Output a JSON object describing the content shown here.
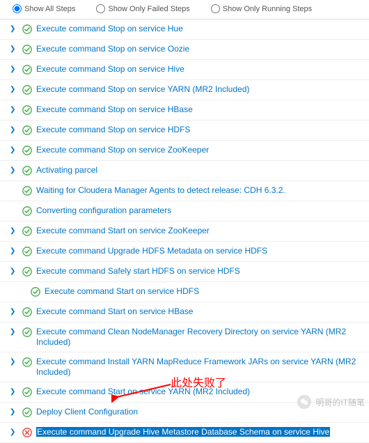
{
  "filters": {
    "all": "Show All Steps",
    "failed": "Show Only Failed Steps",
    "running": "Show Only Running Steps",
    "selected": "all"
  },
  "steps": [
    {
      "label": "Execute command Stop on service Hue",
      "status": "ok",
      "expandable": true
    },
    {
      "label": "Execute command Stop on service Oozie",
      "status": "ok",
      "expandable": true
    },
    {
      "label": "Execute command Stop on service Hive",
      "status": "ok",
      "expandable": true
    },
    {
      "label": "Execute command Stop on service YARN (MR2 Included)",
      "status": "ok",
      "expandable": true
    },
    {
      "label": "Execute command Stop on service HBase",
      "status": "ok",
      "expandable": true
    },
    {
      "label": "Execute command Stop on service HDFS",
      "status": "ok",
      "expandable": true
    },
    {
      "label": "Execute command Stop on service ZooKeeper",
      "status": "ok",
      "expandable": true
    },
    {
      "label": "Activating parcel",
      "status": "ok",
      "expandable": true
    },
    {
      "label": "Waiting for Cloudera Manager Agents to detect release: CDH 6.3.2.",
      "status": "ok",
      "expandable": false
    },
    {
      "label": "Converting configuration parameters",
      "status": "ok",
      "expandable": false
    },
    {
      "label": "Execute command Start on service ZooKeeper",
      "status": "ok",
      "expandable": true
    },
    {
      "label": "Execute command Upgrade HDFS Metadata on service HDFS",
      "status": "ok",
      "expandable": true
    },
    {
      "label": "Execute command Safely start HDFS on service HDFS",
      "status": "ok",
      "expandable": true
    },
    {
      "label": "Execute command Start on service HDFS",
      "status": "ok",
      "expandable": false
    },
    {
      "label": "Execute command Start on service HBase",
      "status": "ok",
      "expandable": true
    },
    {
      "label": "Execute command Clean NodeManager Recovery Directory on service YARN (MR2 Included)",
      "status": "ok",
      "expandable": true
    },
    {
      "label": "Execute command Install YARN MapReduce Framework JARs on service YARN (MR2 Included)",
      "status": "ok",
      "expandable": true
    },
    {
      "label": "Execute command Start on service YARN (MR2 Included)",
      "status": "ok",
      "expandable": true
    },
    {
      "label": "Deploy Client Configuration",
      "status": "ok",
      "expandable": true
    },
    {
      "label": "Execute command Upgrade Hive Metastore Database Schema on service Hive",
      "status": "fail",
      "expandable": true,
      "selected": true
    }
  ],
  "nested_indices": [
    13
  ],
  "annotation": {
    "text": "此处失败了",
    "color": "#ff0000"
  },
  "watermark": {
    "text": "明哥的IT随笔"
  }
}
